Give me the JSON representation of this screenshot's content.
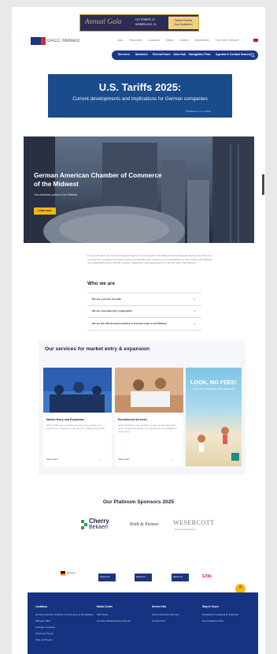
{
  "event_banner": {
    "title": "Annual Gala",
    "date_line1": "OCTOBER 17",
    "date_line2": "WHEELING, IL",
    "cta_line1": "Tables/Tickets",
    "cta_line2": "Now Available!"
  },
  "header": {
    "logo_text": "GACC Midwest",
    "top_links": [
      "Jobs",
      "Resources",
      "Locations",
      "Media",
      "Careers",
      "Newsletters",
      "The GACC Network"
    ],
    "nav": [
      "Services",
      "Members",
      "Events/Tours",
      "Jobs Hub",
      "Navigation Flow",
      "Agenda & Contact",
      "Search"
    ]
  },
  "tariff_banner": {
    "title": "U.S. Tariffs 2025:",
    "subtitle": "Current developments and  implications for German companies",
    "note": "Publikation in our Portal"
  },
  "hero": {
    "title": "German American Chamber of Commerce of the Midwest",
    "subtitle": "Your business partner in the Midwest",
    "button": "Learn more"
  },
  "intro": {
    "text": "For over 50 years, the German American Chamber of Commerce® of the Midwest (GACC Midwest) has been the first point of contact for companies from both countries and will help them, helping you to successfully enter the market in the Midwest. As a sustainable service provider, member organization, and representative of German trade in the Midwest."
  },
  "who_we_are": {
    "title": "Who we are",
    "items": [
      "We are a service provider",
      "We are a membership organization",
      "We are the official representative of German trade in the Midwest"
    ]
  },
  "services": {
    "title": "Our services for market entry & expansion",
    "cards": [
      {
        "title": "Market Entry and Expansion",
        "desc": "With our 50 years of experience and strong network, we support your company to enter the U.S. market successfully.",
        "link": "View more"
      },
      {
        "title": "Recruitment Services",
        "desc": "GACC Midwest is your partner to assist you throughout the entire recruitment process, from identifying top candidates to onboarding.",
        "link": "View more"
      }
    ],
    "promo": {
      "headline": "LOOK, NO FEES!",
      "sub": "GACC HAS MEMBERS-ONLY BENEFITS"
    }
  },
  "sponsors": {
    "title": "Our Platinum Sponsors 2025",
    "names": [
      "Cherry",
      "Bekaert",
      "Rödl & Partner",
      "WESERCOTT",
      "Member Network Partner"
    ]
  },
  "partners": [
    "Sponsor A",
    "Sponsor B",
    "Sponsor C",
    "Sponsor D",
    "GTAI"
  ],
  "footer": {
    "columns": [
      {
        "heading": "Locations",
        "links": [
          "German American Chamber of Commerce of the Midwest",
          "Michigan office",
          "Lexington Kentucky",
          "Wisconsin People",
          "Ohio and People"
        ]
      },
      {
        "heading": "Media Center",
        "links": [
          "Web News",
          "Germany Midwest Report Results"
        ]
      },
      {
        "heading": "Service Hub",
        "links": [
          "GTAI Local Delta Germany",
          "Contact Form"
        ]
      },
      {
        "heading": "Stay in Touch",
        "links": [
          "Newsletter Anmeldung für Deutsche",
          "Get a Magazine Now"
        ]
      }
    ]
  },
  "colors": {
    "navy": "#18388a",
    "accent": "#f3b80e",
    "tariff_blue": "#1a4b8c"
  }
}
